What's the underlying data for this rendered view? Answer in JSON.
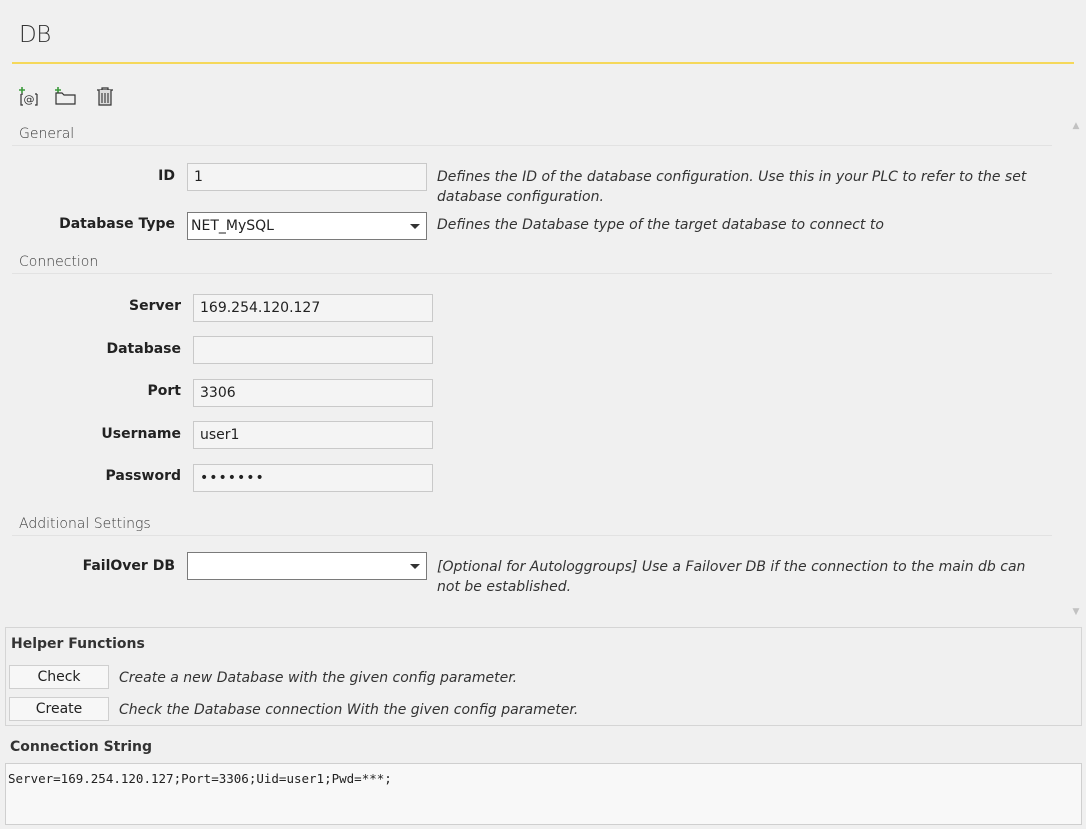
{
  "title": "DB",
  "toolbar": {
    "icons": [
      "add-connection-icon",
      "new-folder-icon",
      "delete-icon"
    ]
  },
  "sections": {
    "general": "General",
    "connection": "Connection",
    "additional": "Additional Settings"
  },
  "general": {
    "id_label": "ID",
    "id_value": "1",
    "id_desc": "Defines the ID of the database configuration. Use this in your PLC to refer to the set database configuration.",
    "dbtype_label": "Database Type",
    "dbtype_value": "NET_MySQL",
    "dbtype_desc": "Defines the Database type of the target database to connect to"
  },
  "connection": {
    "server_label": "Server",
    "server_value": "169.254.120.127",
    "database_label": "Database",
    "database_value": "",
    "port_label": "Port",
    "port_value": "3306",
    "username_label": "Username",
    "username_value": "user1",
    "password_label": "Password",
    "password_value": "•••••••"
  },
  "additional": {
    "failover_label": "FailOver DB",
    "failover_value": "",
    "failover_desc": "[Optional for Autologgroups] Use a Failover DB if the connection to the main db can not be established."
  },
  "helper": {
    "title": "Helper Functions",
    "check_label": "Check",
    "check_desc": "Create a new Database with the given config parameter.",
    "create_label": "Create",
    "create_desc": "Check the Database connection With the given config parameter."
  },
  "connection_string": {
    "title": "Connection String",
    "value": "Server=169.254.120.127;Port=3306;Uid=user1;Pwd=***;"
  },
  "colors": {
    "accent_rule": "#f5d85a"
  }
}
